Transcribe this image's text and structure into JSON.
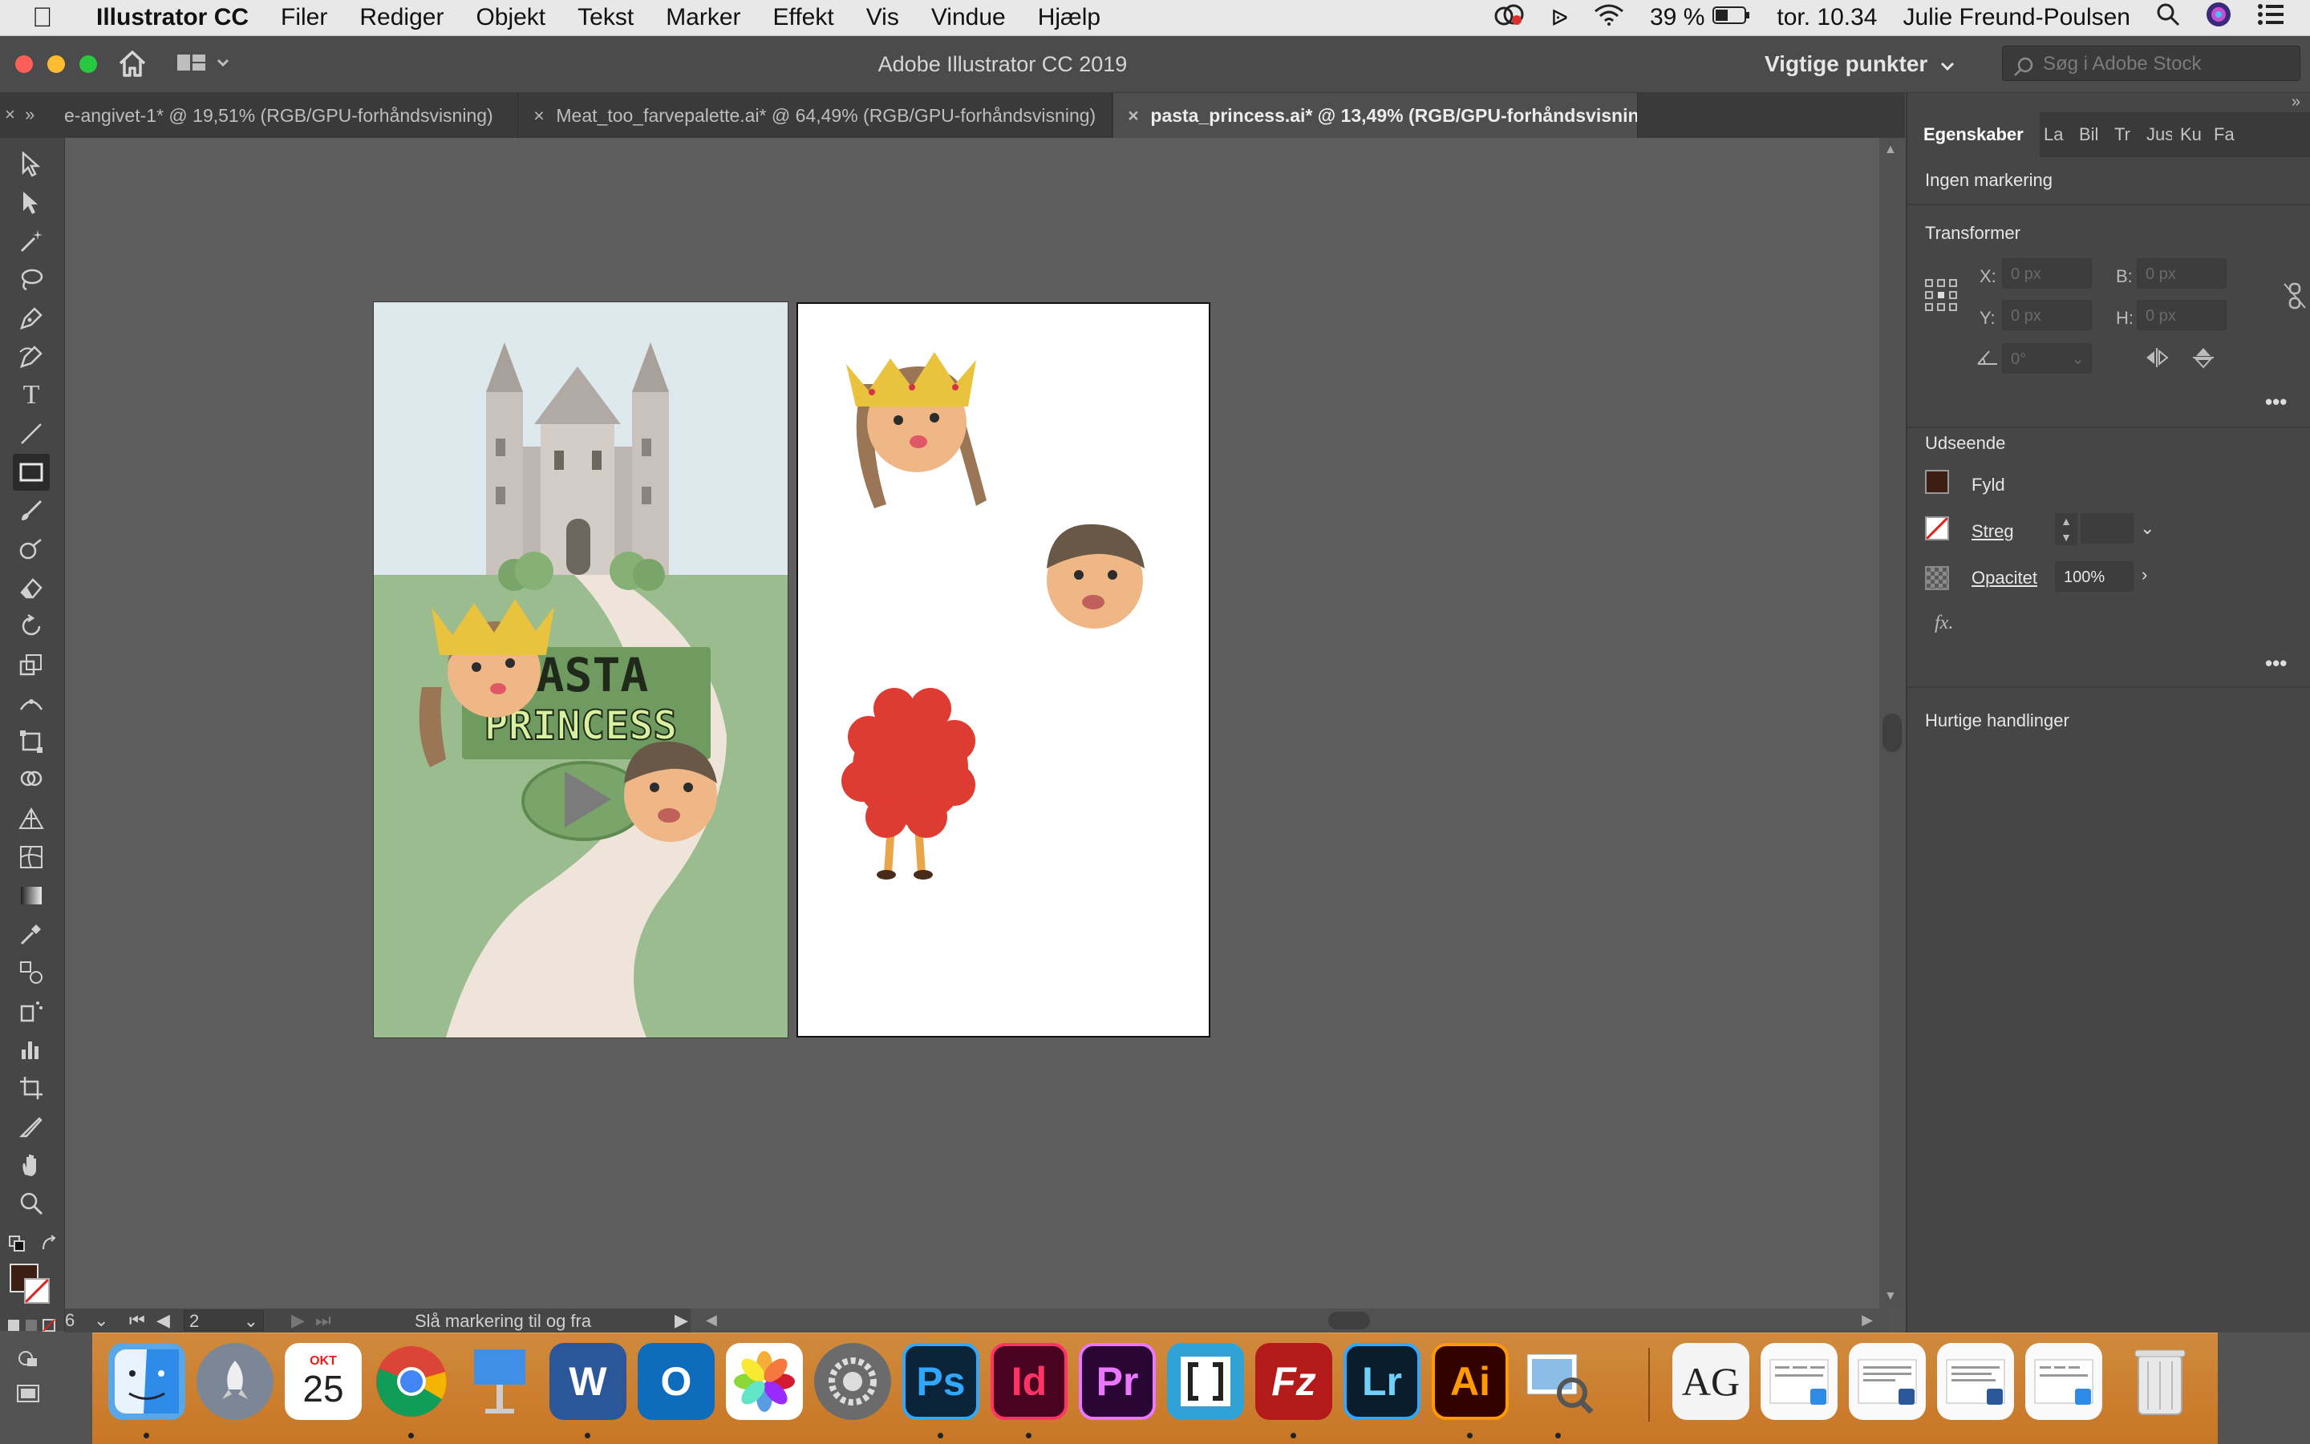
{
  "menubar": {
    "app_name": "Illustrator CC",
    "items": [
      "Filer",
      "Rediger",
      "Objekt",
      "Tekst",
      "Marker",
      "Effekt",
      "Vis",
      "Vindue",
      "Hjælp"
    ],
    "battery": "39 %",
    "clock": "tor. 10.34",
    "user": "Julie Freund-Poulsen"
  },
  "window": {
    "title": "Adobe Illustrator CC 2019",
    "workspace": "Vigtige punkter",
    "stock_placeholder": "Søg i Adobe Stock"
  },
  "doc_tabs": [
    {
      "label": "e-angivet-1* @ 19,51% (RGB/GPU-forhåndsvisning)"
    },
    {
      "label": "Meat_too_farvepalette.ai* @ 64,49% (RGB/GPU-forhåndsvisning)"
    },
    {
      "label": "pasta_princess.ai* @ 13,49% (RGB/GPU-forhåndsvisning)"
    }
  ],
  "artwork": {
    "title_line1": "PASTA",
    "title_line2": "PRINCESS"
  },
  "status": {
    "zoom": "6",
    "artboard_number": "2",
    "message": "Slå markering til og fra"
  },
  "panel": {
    "tabs": [
      "Egenskaber",
      "La",
      "Bil",
      "Tr",
      "Jus",
      "Ku",
      "Fa"
    ],
    "no_selection": "Ingen markering",
    "transform_title": "Transformer",
    "x_label": "X:",
    "x_value": "0 px",
    "y_label": "Y:",
    "y_value": "0 px",
    "w_label": "B:",
    "w_value": "0 px",
    "h_label": "H:",
    "h_value": "0 px",
    "angle_value": "0°",
    "appearance_title": "Udseende",
    "fill_label": "Fyld",
    "stroke_label": "Streg",
    "opacity_label": "Opacitet",
    "opacity_value": "100%",
    "fx_label": "fx.",
    "quick_actions_title": "Hurtige handlinger"
  },
  "colors": {
    "fill_swatch": "#3c1f12",
    "accent_sky": "#dde9ec",
    "accent_grass": "#9bbc8f"
  },
  "dock": {
    "calendar_month": "OKT",
    "calendar_day": "25",
    "apps": [
      "Finder",
      "Launchpad",
      "Kalender",
      "Chrome",
      "Keynote",
      "Word",
      "Outlook",
      "Fotos",
      "Systemindstillinger",
      "Ps",
      "Id",
      "Pr",
      "Brackets",
      "Fz",
      "Lr",
      "Ai",
      "Forhåndsvisning"
    ],
    "doc_text": "AG"
  }
}
